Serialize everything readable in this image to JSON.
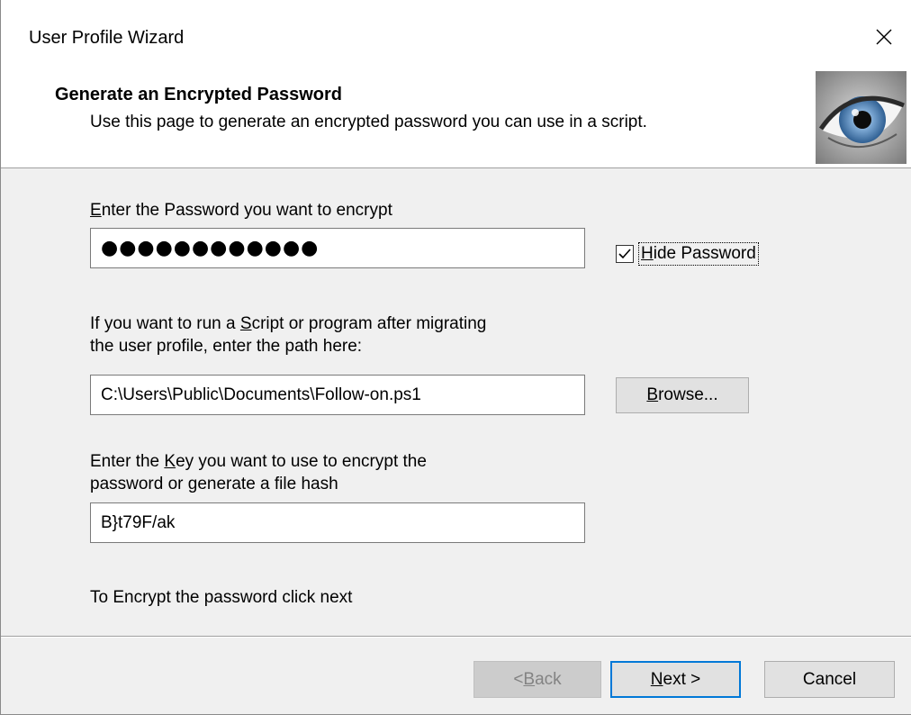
{
  "window": {
    "title": "User Profile Wizard"
  },
  "header": {
    "title": "Generate an Encrypted Password",
    "subtitle": "Use this page to generate an encrypted password you can use in a script."
  },
  "password": {
    "label_pre": "",
    "label_mnemonic": "E",
    "label_post": "nter the Password you want to encrypt",
    "value_masked": "●●●●●●●●●●●●",
    "hide_checkbox": {
      "checked": true,
      "label_mnemonic": "H",
      "label_post": "ide Password"
    }
  },
  "script": {
    "label_line1_pre": "If you want to run a ",
    "label_line1_mnemonic": "S",
    "label_line1_post": "cript or program after migrating",
    "label_line2": "the user profile, enter the path here:",
    "path_value": "C:\\Users\\Public\\Documents\\Follow-on.ps1",
    "browse_mnemonic": "B",
    "browse_post": "rowse..."
  },
  "key": {
    "label_line1_pre": "Enter the ",
    "label_line1_mnemonic": "K",
    "label_line1_post": "ey you want to use to encrypt the",
    "label_line2": "password or generate a file hash",
    "value": "B}t79F/ak"
  },
  "instruction": "To Encrypt the password click next",
  "buttons": {
    "back_pre": "< ",
    "back_mnemonic": "B",
    "back_post": "ack",
    "next_mnemonic": "N",
    "next_post": "ext >",
    "cancel": "Cancel"
  },
  "colors": {
    "dialog_background": "#f0f0f0",
    "focus_accent": "#0078d7",
    "disabled_text": "#838383"
  },
  "icons": {
    "close": "close-icon",
    "header_logo": "eye-logo",
    "checkbox": "checkmark-icon"
  }
}
